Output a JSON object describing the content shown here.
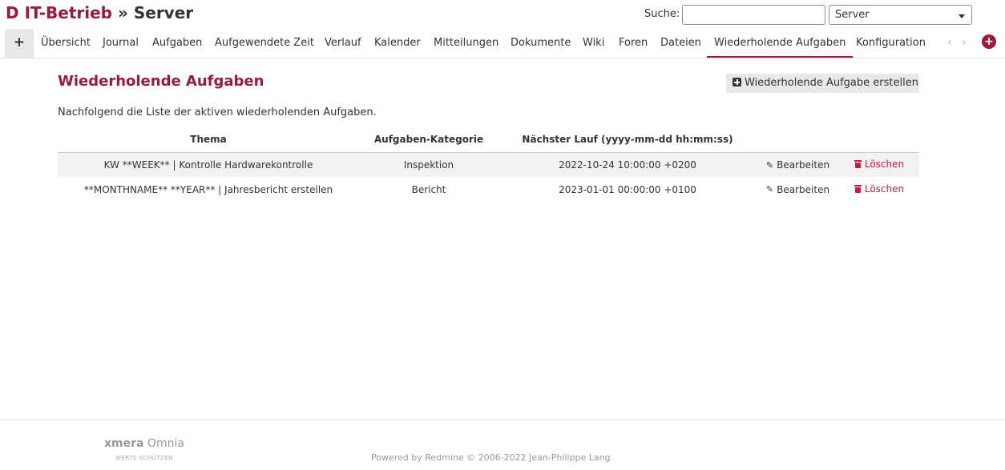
{
  "header": {
    "project_parent": "D IT-Betrieb",
    "separator": "»",
    "project_name": "Server",
    "search_label": "Suche:",
    "search_value": "",
    "project_select_value": "Server"
  },
  "menu": {
    "add_label": "+",
    "items": [
      {
        "label": "Übersicht"
      },
      {
        "label": "Journal"
      },
      {
        "label": "Aufgaben"
      },
      {
        "label": "Aufgewendete Zeit"
      },
      {
        "label": "Verlauf"
      },
      {
        "label": "Kalender"
      },
      {
        "label": "Mitteilungen"
      },
      {
        "label": "Dokumente"
      },
      {
        "label": "Wiki"
      },
      {
        "label": "Foren"
      },
      {
        "label": "Dateien"
      },
      {
        "label": "Wiederholende Aufgaben",
        "selected": true
      },
      {
        "label": "Konfiguration"
      }
    ],
    "prev_arrow": "‹",
    "next_arrow": "›",
    "new_item_label": "+"
  },
  "content": {
    "heading": "Wiederholende Aufgaben",
    "new_button_label": "Wiederholende Aufgabe erstellen",
    "intro": "Nachfolgend die Liste der aktiven wiederholenden Aufgaben.",
    "table": {
      "headers": [
        "Thema",
        "Aufgaben-Kategorie",
        "Nächster Lauf (yyyy-mm-dd hh:mm:ss)"
      ],
      "edit_label": "Bearbeiten",
      "delete_label": "Löschen",
      "rows": [
        {
          "subject": "KW **WEEK** | Kontrolle Hardwarekontrolle",
          "category": "Inspektion",
          "next_run": "2022-10-24 10:00:00 +0200"
        },
        {
          "subject": "**MONTHNAME** **YEAR** | Jahresbericht erstellen",
          "category": "Bericht",
          "next_run": "2023-01-01 00:00:00 +0100"
        }
      ]
    }
  },
  "footer": {
    "brand_bold": "xmera",
    "brand_rest": " Omnia",
    "tagline": "WERTE SCHÜTZEN",
    "powered_by": "Powered by Redmine © 2006-2022 Jean-Philippe Lang"
  },
  "colors": {
    "accent": "#9a1a3c",
    "delete": "#cc1a3c"
  }
}
